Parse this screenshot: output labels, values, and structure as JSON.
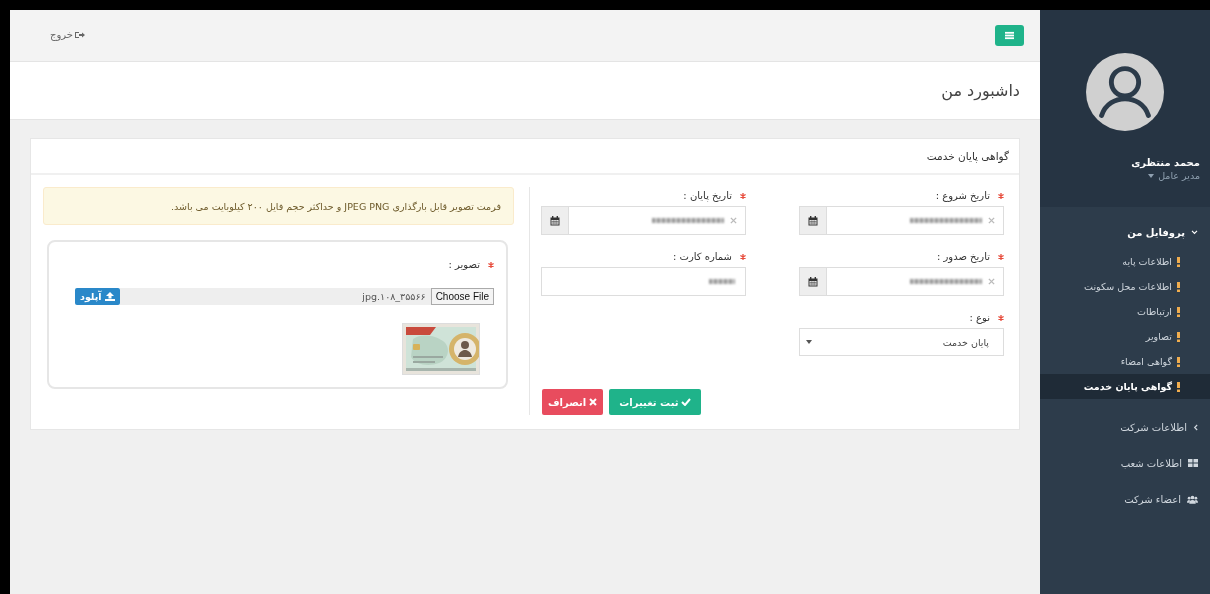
{
  "topbar": {
    "logout": "خروج"
  },
  "page_title": "داشبورد من",
  "sidebar": {
    "user": {
      "name": "محمد منتظری",
      "role": "مدیر عامل"
    },
    "menu": [
      {
        "label": "پروفایل من",
        "kind": "group",
        "expanded": true,
        "children": [
          {
            "label": "اطلاعات پایه",
            "selected": false
          },
          {
            "label": "اطلاعات محل سکونت",
            "selected": false
          },
          {
            "label": "ارتباطات",
            "selected": false
          },
          {
            "label": "تصاویر",
            "selected": false
          },
          {
            "label": "گواهی امضاء",
            "selected": false
          },
          {
            "label": "گواهی پایان خدمت",
            "selected": true
          }
        ]
      },
      {
        "label": "اطلاعات شرکت",
        "kind": "group",
        "expanded": false
      },
      {
        "label": "اطلاعات شعب",
        "kind": "grid"
      },
      {
        "label": "اعضاء شرکت",
        "kind": "users"
      }
    ]
  },
  "card": {
    "title": "گواهی پایان خدمت",
    "fields": [
      {
        "label": "تاریخ شروع :",
        "kind": "date",
        "required": true
      },
      {
        "label": "تاریخ پایان :",
        "kind": "date",
        "required": true
      },
      {
        "label": "تاریخ صدور :",
        "kind": "date",
        "required": true
      },
      {
        "label": "شماره کارت :",
        "kind": "text",
        "required": true
      },
      {
        "label": "نوع :",
        "kind": "select",
        "required": true,
        "value": "پایان خدمت"
      }
    ],
    "buttons": [
      {
        "label": "ثبت تغییرات",
        "kind": "save"
      },
      {
        "label": "انصراف",
        "kind": "cancel"
      }
    ],
    "notice": "فرمت تصویر قابل بارگذاری JPEG PNG و حداکثر حجم فایل ۲۰۰ کیلوبایت می باشد.",
    "upload": {
      "label": "تصویر :",
      "required": true,
      "choose": "Choose File",
      "file_name": "jpg.۱۰۸_۳۵۵۶۶",
      "button": "آپلود"
    }
  }
}
